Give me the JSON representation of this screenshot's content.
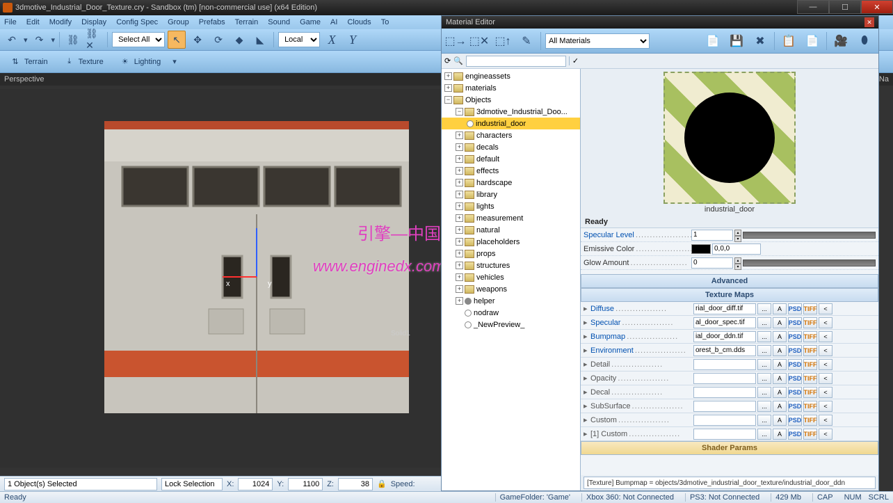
{
  "window": {
    "title": "3dmotive_Industrial_Door_Texture.cry - Sandbox (tm) [non-commercial use] (x64 Edition)"
  },
  "menu": [
    "File",
    "Edit",
    "Modify",
    "Display",
    "Config Spec",
    "Group",
    "Prefabs",
    "Terrain",
    "Sound",
    "Game",
    "AI",
    "Clouds",
    "To"
  ],
  "toolbar": {
    "select_mode": "Select All",
    "coord_space": "Local",
    "axes": [
      "X",
      "Y"
    ]
  },
  "modes": {
    "terrain": "Terrain",
    "texture": "Texture",
    "lighting": "Lighting"
  },
  "viewport": {
    "label": "Perspective",
    "right_label": "By Na",
    "solid_label": "Solid1",
    "axis_x": "x",
    "axis_y": "y"
  },
  "statusbar": {
    "selection": "1 Object(s) Selected",
    "lock": "Lock Selection",
    "x_label": "X:",
    "x": "1024",
    "y_label": "Y:",
    "y": "1100",
    "z_label": "Z:",
    "z": "38",
    "speed_label": "Speed:"
  },
  "bottom": {
    "ready": "Ready",
    "gamefolder": "GameFolder: 'Game'",
    "xbox": "Xbox 360: Not Connected",
    "ps3": "PS3: Not Connected",
    "mem": "429 Mb",
    "cap": "CAP",
    "num": "NUM",
    "scrl": "SCRL"
  },
  "mateditor": {
    "title": "Material Editor",
    "filter": "All Materials",
    "preview_caption": "industrial_door",
    "status": "Ready",
    "tree": {
      "root": "engineassets",
      "n1": "materials",
      "n2": "Objects",
      "n3": "3dmotive_Industrial_Doo...",
      "n4": "industrial_door",
      "others": [
        "characters",
        "decals",
        "default",
        "effects",
        "hardscape",
        "library",
        "lights",
        "measurement",
        "natural",
        "placeholders",
        "props",
        "structures",
        "vehicles",
        "weapons",
        "helper",
        "nodraw",
        "_NewPreview_"
      ]
    },
    "props": {
      "spec_level": {
        "label": "Specular Level",
        "value": "1"
      },
      "emissive": {
        "label": "Emissive Color",
        "value": "0,0,0"
      },
      "glow": {
        "label": "Glow Amount",
        "value": "0"
      }
    },
    "sections": {
      "advanced": "Advanced",
      "texmaps": "Texture Maps",
      "shader": "Shader Params"
    },
    "texmaps": [
      {
        "label": "Diffuse",
        "cls": "blue",
        "file": "rial_door_diff.tif"
      },
      {
        "label": "Specular",
        "cls": "blue",
        "file": "al_door_spec.tif"
      },
      {
        "label": "Bumpmap",
        "cls": "blue",
        "file": "ial_door_ddn.tif"
      },
      {
        "label": "Environment",
        "cls": "blue",
        "file": "orest_b_cm.dds"
      },
      {
        "label": "Detail",
        "cls": "gray",
        "file": ""
      },
      {
        "label": "Opacity",
        "cls": "gray",
        "file": ""
      },
      {
        "label": "Decal",
        "cls": "gray",
        "file": ""
      },
      {
        "label": "SubSurface",
        "cls": "gray",
        "file": ""
      },
      {
        "label": "Custom",
        "cls": "gray",
        "file": ""
      },
      {
        "label": "[1] Custom",
        "cls": "gray",
        "file": ""
      }
    ],
    "btnlabels": {
      "browse": "...",
      "alpha": "A",
      "psd": "PSD",
      "tiff": "TIFF",
      "lt": "<"
    },
    "path": "[Texture] Bumpmap = objects/3dmotive_industrial_door_texture/industrial_door_ddn"
  },
  "watermark": {
    "url": "www.enginedx.com",
    "cn": "引擎—中国"
  }
}
